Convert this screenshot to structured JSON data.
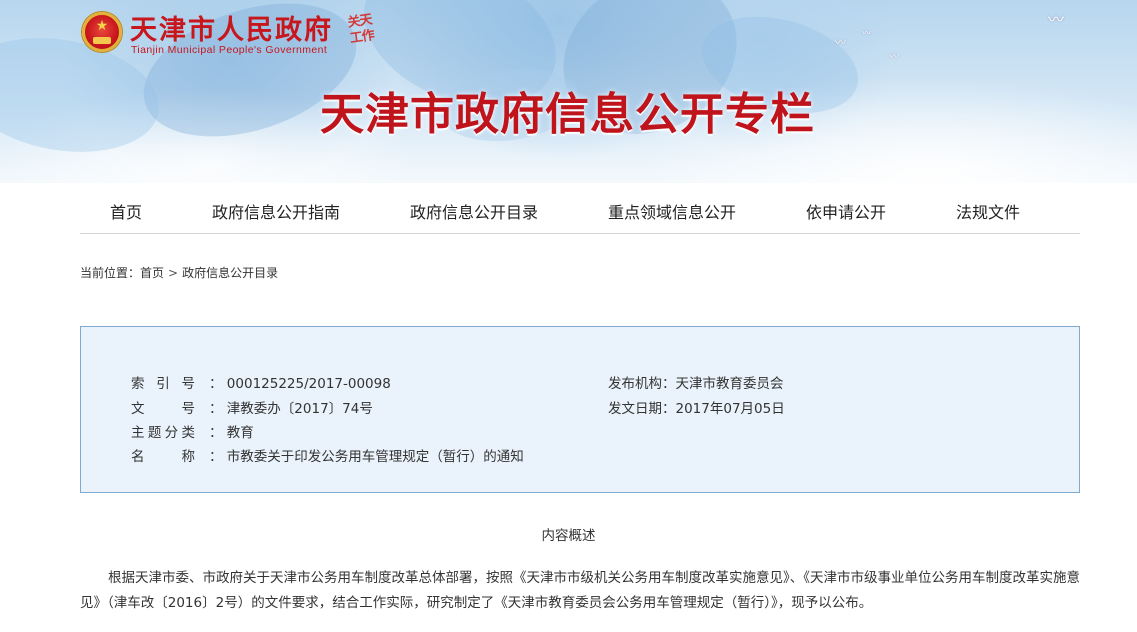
{
  "header": {
    "site_name": "天津市人民政府",
    "site_name_en": "Tianjin Municipal People's Government",
    "seal_text": "关天工作",
    "banner_title": "天津市政府信息公开专栏"
  },
  "nav": {
    "items": [
      {
        "label": "首页"
      },
      {
        "label": "政府信息公开指南"
      },
      {
        "label": "政府信息公开目录"
      },
      {
        "label": "重点领域信息公开"
      },
      {
        "label": "依申请公开"
      },
      {
        "label": "法规文件"
      }
    ]
  },
  "breadcrumb": {
    "prefix": "当前位置：",
    "items": [
      "首页",
      "政府信息公开目录"
    ],
    "separator": ">"
  },
  "info": {
    "index_label": [
      "索",
      "引",
      "号"
    ],
    "index_value": "000125225/2017-00098",
    "doc_no_label": [
      "文",
      "号"
    ],
    "doc_no_value": "津教委办〔2017〕74号",
    "topic_label": [
      "主",
      "题",
      "分",
      "类"
    ],
    "topic_value": "教育",
    "name_label": [
      "名",
      "称"
    ],
    "name_value": "市教委关于印发公务用车管理规定（暂行）的通知",
    "publisher_label": "发布机构：",
    "publisher_value": "天津市教育委员会",
    "date_label": "发文日期：",
    "date_value": "2017年07月05日",
    "colon": "："
  },
  "content": {
    "summary_title": "内容概述",
    "paragraph": "根据天津市委、市政府关于天津市公务用车制度改革总体部署，按照《天津市市级机关公务用车制度改革实施意见》、《天津市市级事业单位公务用车制度改革实施意见》（津车改〔2016〕2号）的文件要求，结合工作实际，研究制定了《天津市教育委员会公务用车管理规定（暂行）》，现予以公布。"
  },
  "colors": {
    "brand_red": "#c8161d",
    "info_bg": "#eaf3fb",
    "info_border": "#7fa9cf"
  }
}
